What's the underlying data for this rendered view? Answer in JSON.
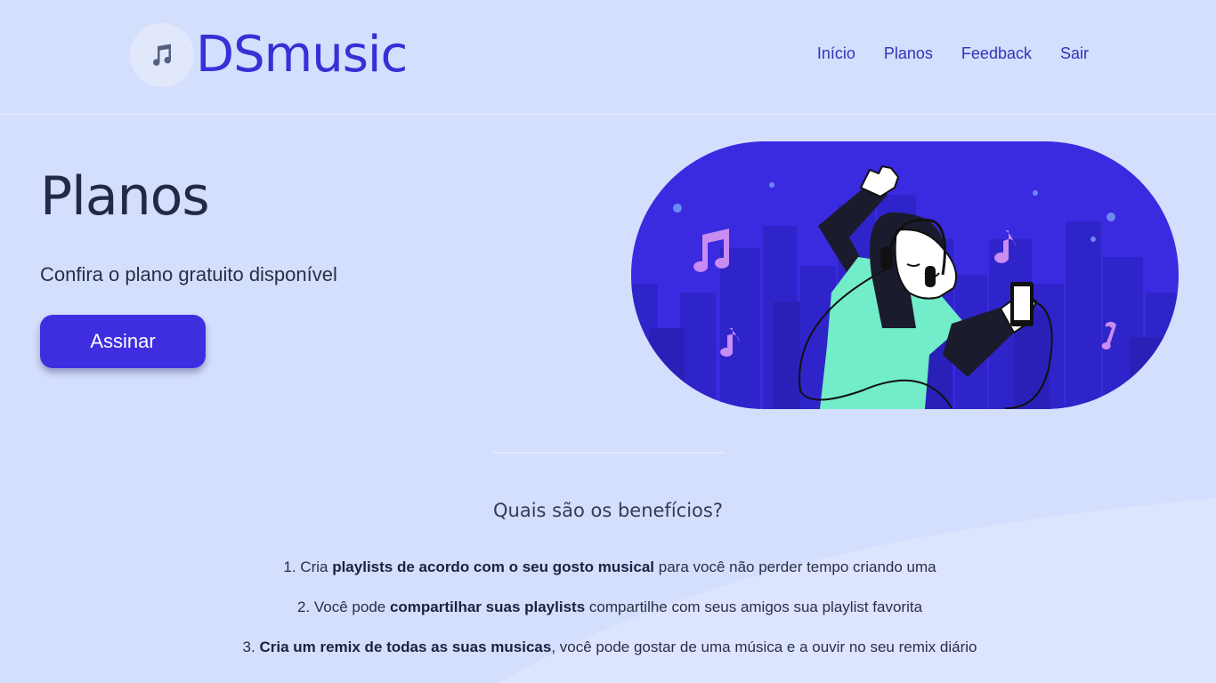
{
  "brand": {
    "name": "DSmusic",
    "icon": "music-note-icon"
  },
  "nav": {
    "items": [
      "Início",
      "Planos",
      "Feedback",
      "Sair"
    ]
  },
  "hero": {
    "title": "Planos",
    "subtitle": "Confira o plano gratuito disponível",
    "cta_label": "Assinar"
  },
  "benefits": {
    "title": "Quais são os benefícios?",
    "items": [
      {
        "num": "1.",
        "pre": "Cria ",
        "bold": "playlists de acordo com o seu gosto musical",
        "post": " para você não perder tempo criando uma"
      },
      {
        "num": "2.",
        "pre": "Você pode ",
        "bold": "compartilhar suas playlists",
        "post": " compartilhe com seus amigos sua playlist favorita"
      },
      {
        "num": "3.",
        "pre": "",
        "bold": "Cria um remix de todas as suas musicas",
        "post": ", você pode gostar de uma música e a ouvir no seu remix diário"
      }
    ]
  },
  "colors": {
    "background": "#d4defd",
    "accent": "#3f2ee0",
    "brand_text": "#3730d6",
    "illustration_bg": "#3a2ae0",
    "buildings": "#2f25c8",
    "shirt": "#72ecc9",
    "music_notes": "#c88cf2"
  }
}
